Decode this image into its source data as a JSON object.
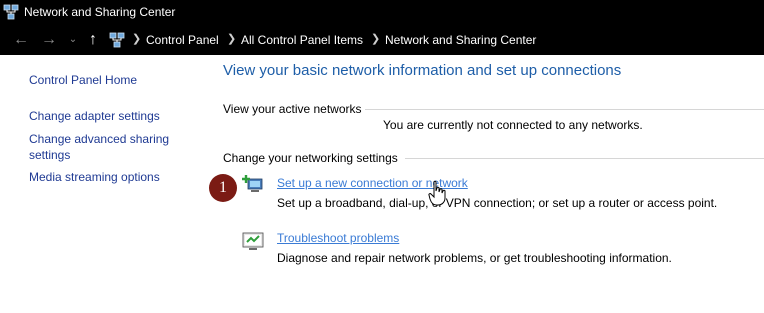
{
  "window": {
    "title": "Network and Sharing Center",
    "app_icon": "network-icon"
  },
  "address_bar": {
    "nav": {
      "back_icon": "arrow-left-icon",
      "forward_icon": "arrow-right-icon",
      "recent_icon": "chevron-down-icon",
      "up_icon": "arrow-up-icon"
    },
    "location_icon": "control-panel-icon",
    "crumbs": [
      "Control Panel",
      "All Control Panel Items",
      "Network and Sharing Center"
    ]
  },
  "sidebar": {
    "items": [
      {
        "label": "Control Panel Home"
      },
      {
        "label": "Change adapter settings"
      },
      {
        "label": "Change advanced sharing settings"
      },
      {
        "label": "Media streaming options"
      }
    ]
  },
  "main": {
    "heading": "View your basic network information and set up connections",
    "active_networks": {
      "label": "View your active networks",
      "status": "You are currently not connected to any networks."
    },
    "change_settings": {
      "label": "Change your networking settings",
      "tasks": [
        {
          "icon": "new-connection-icon",
          "link": "Set up a new connection or network",
          "description": "Set up a broadband, dial-up, or VPN connection; or set up a router or access point."
        },
        {
          "icon": "troubleshoot-icon",
          "link": "Troubleshoot problems",
          "description": "Diagnose and repair network problems, or get troubleshooting information."
        }
      ]
    }
  },
  "annotation": {
    "step": "1",
    "color": "#7b1b14"
  }
}
